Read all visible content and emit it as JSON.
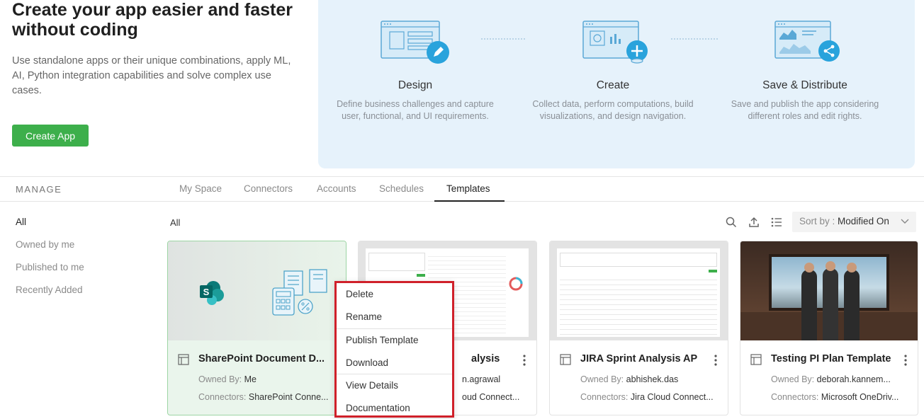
{
  "hero": {
    "title": "Create your app easier and faster\nwithout coding",
    "description": "Use standalone apps or their unique combinations, apply ML, AI, Python integration capabilities and solve complex use cases.",
    "create_button": "Create App",
    "steps": [
      {
        "title": "Design",
        "description": "Define business challenges and capture user, functional, and UI requirements."
      },
      {
        "title": "Create",
        "description": "Collect data, perform computations, build visualizations, and design navigation."
      },
      {
        "title": "Save & Distribute",
        "description": "Save and publish the app considering different roles and edit rights."
      }
    ]
  },
  "nav": {
    "section_label": "MANAGE",
    "tabs": [
      "My Space",
      "Connectors",
      "Accounts",
      "Schedules",
      "Templates"
    ],
    "active_tab": "Templates"
  },
  "sidebar": {
    "items": [
      "All",
      "Owned by me",
      "Published to me",
      "Recently Added"
    ],
    "active": "All"
  },
  "content": {
    "filter_label": "All",
    "sort_label": "Sort by :",
    "sort_value": "Modified On"
  },
  "cards": [
    {
      "title": "SharePoint Document D...",
      "owned_label": "Owned By:",
      "owner": "Me",
      "connectors_label": "Connectors:",
      "connectors": "SharePoint Conne..."
    },
    {
      "title": "alysis",
      "owned_label": "",
      "owner": "n.agrawal",
      "connectors_label": "",
      "connectors": "oud Connect..."
    },
    {
      "title": "JIRA Sprint Analysis AP",
      "owned_label": "Owned By:",
      "owner": "abhishek.das",
      "connectors_label": "Connectors:",
      "connectors": "Jira Cloud Connect..."
    },
    {
      "title": "Testing PI Plan Template",
      "owned_label": "Owned By:",
      "owner": "deborah.kannem...",
      "connectors_label": "Connectors:",
      "connectors": "Microsoft OneDriv..."
    }
  ],
  "context_menu": {
    "items": [
      "Delete",
      "Rename",
      "Publish Template",
      "Download",
      "View Details",
      "Documentation"
    ]
  },
  "colors": {
    "primary_green": "#3daf4b",
    "hero_panel": "#e6f2fb",
    "icon_blue": "#29a3dc",
    "menu_highlight": "#d0202a"
  }
}
